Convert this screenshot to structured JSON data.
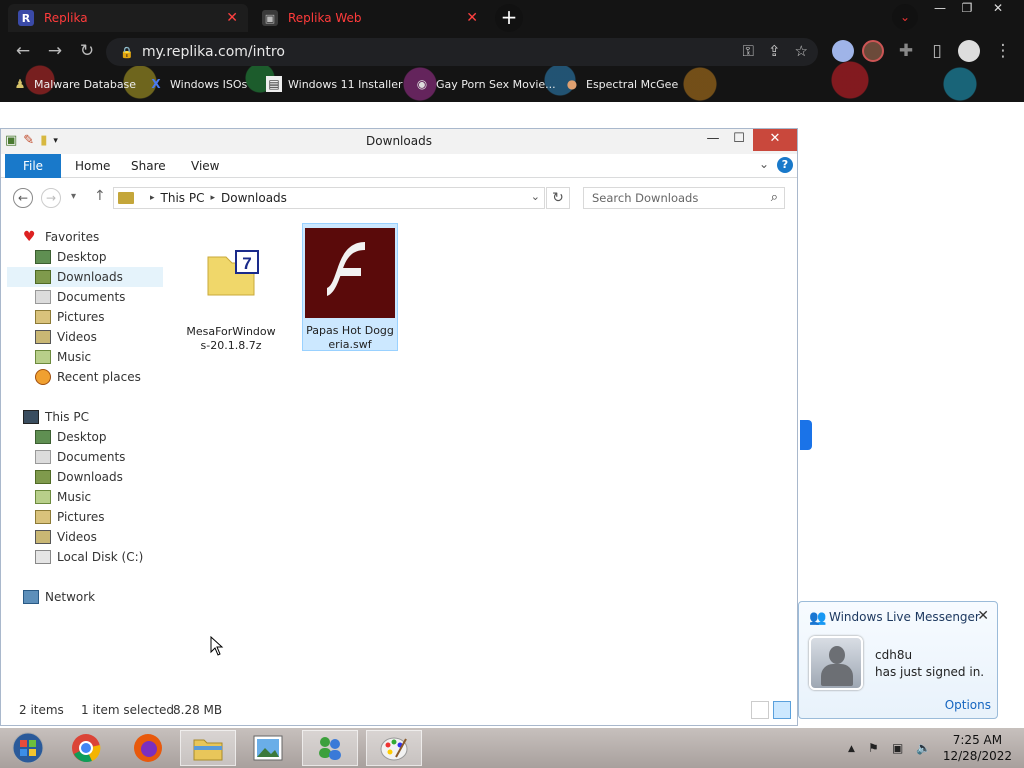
{
  "browser": {
    "tabs": [
      {
        "title": "Replika",
        "favicon": "R"
      },
      {
        "title": "Replika Web",
        "favicon": "image-icon"
      }
    ],
    "address": "my.replika.com/intro",
    "bookmarks": [
      {
        "label": "Malware Database"
      },
      {
        "label": "Windows ISOs"
      },
      {
        "label": "Windows 11 Installer"
      },
      {
        "label": "Gay Porn Sex Movie..."
      },
      {
        "label": "Espectral McGee"
      }
    ]
  },
  "explorer": {
    "title": "Downloads",
    "ribbon_tabs": {
      "file": "File",
      "home": "Home",
      "share": "Share",
      "view": "View"
    },
    "breadcrumb": {
      "root": "This PC",
      "current": "Downloads"
    },
    "search_placeholder": "Search Downloads",
    "nav": {
      "favorites": "Favorites",
      "fav_desktop": "Desktop",
      "fav_downloads": "Downloads",
      "fav_documents": "Documents",
      "fav_pictures": "Pictures",
      "fav_videos": "Videos",
      "fav_music": "Music",
      "fav_recent": "Recent places",
      "this_pc": "This PC",
      "pc_desktop": "Desktop",
      "pc_documents": "Documents",
      "pc_downloads": "Downloads",
      "pc_music": "Music",
      "pc_pictures": "Pictures",
      "pc_videos": "Videos",
      "pc_disk": "Local Disk (C:)",
      "network": "Network"
    },
    "files": [
      {
        "name": "MesaForWindows-20.1.8.7z",
        "type": "7z-archive-icon",
        "selected": false
      },
      {
        "name": "Papas Hot Doggeria.swf",
        "type": "flash-file-icon",
        "selected": true
      }
    ],
    "status": {
      "count": "2 items",
      "selection": "1 item selected",
      "size": "8.28 MB"
    }
  },
  "toast": {
    "app": "Windows Live Messenger",
    "user": "cdh8u",
    "message": "has just signed in.",
    "options": "Options"
  },
  "taskbar": {
    "time": "7:25 AM",
    "date": "12/28/2022"
  },
  "colors": {
    "accent_blue": "#1979ca",
    "tab_red": "#ff3b3b",
    "flash_bg": "#5a0a0a"
  }
}
